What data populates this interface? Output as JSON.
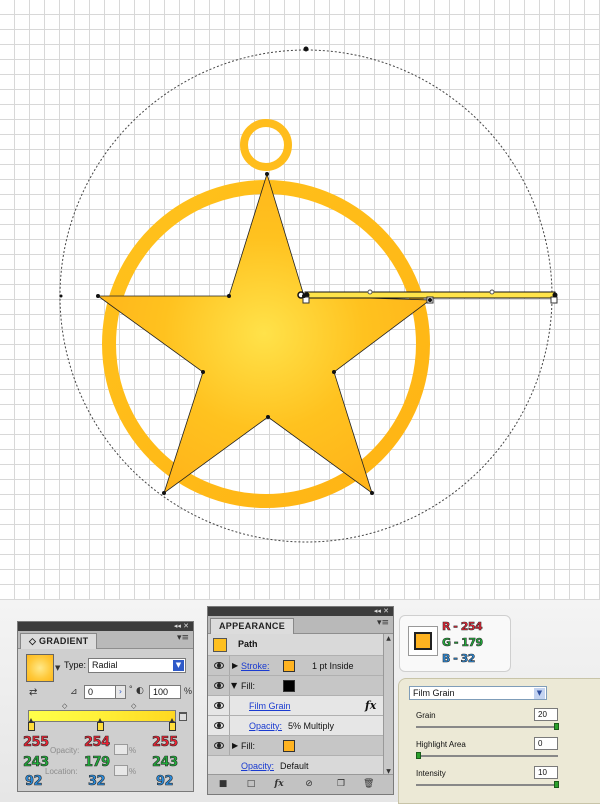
{
  "gradient_panel": {
    "tab_title": "GRADIENT",
    "type_label": "Type:",
    "type_value": "Radial",
    "angle_value": "0",
    "angle_unit": "°",
    "aspect_value": "100",
    "aspect_unit": "%",
    "opacity_label": "Opacity:",
    "location_label": "Location:",
    "ghost_unit": "%"
  },
  "rgb_annotations": {
    "col1": {
      "r": "255",
      "g": "243",
      "b": "92"
    },
    "col2": {
      "r": "254",
      "g": "179",
      "b": "32"
    },
    "col3": {
      "r": "255",
      "g": "243",
      "b": "92"
    }
  },
  "appearance_panel": {
    "tab_title": "APPEARANCE",
    "path_label": "Path",
    "stroke_label": "Stroke:",
    "stroke_value": "1 pt  Inside",
    "stroke_color": "#ffb320",
    "fill1_label": "Fill:",
    "fill1_color": "#000000",
    "effect_label": "Film Grain",
    "opacity_label": "Opacity:",
    "opacity_value": "5% Multiply",
    "fill2_label": "Fill:",
    "fill2_color": "#ffb320",
    "bottom_opacity_label": "Opacity:",
    "bottom_opacity_value": "Default",
    "fx_symbol": "fx"
  },
  "color_box": {
    "swatch_color": "#ffb320",
    "r_text": "R - 254",
    "g_text": "G - 179",
    "b_text": "B - 32"
  },
  "film_grain_panel": {
    "dropdown_value": "Film Grain",
    "grain_label": "Grain",
    "grain_value": "20",
    "highlight_label": "Highlight Area",
    "highlight_value": "0",
    "intensity_label": "Intensity",
    "intensity_value": "10"
  }
}
